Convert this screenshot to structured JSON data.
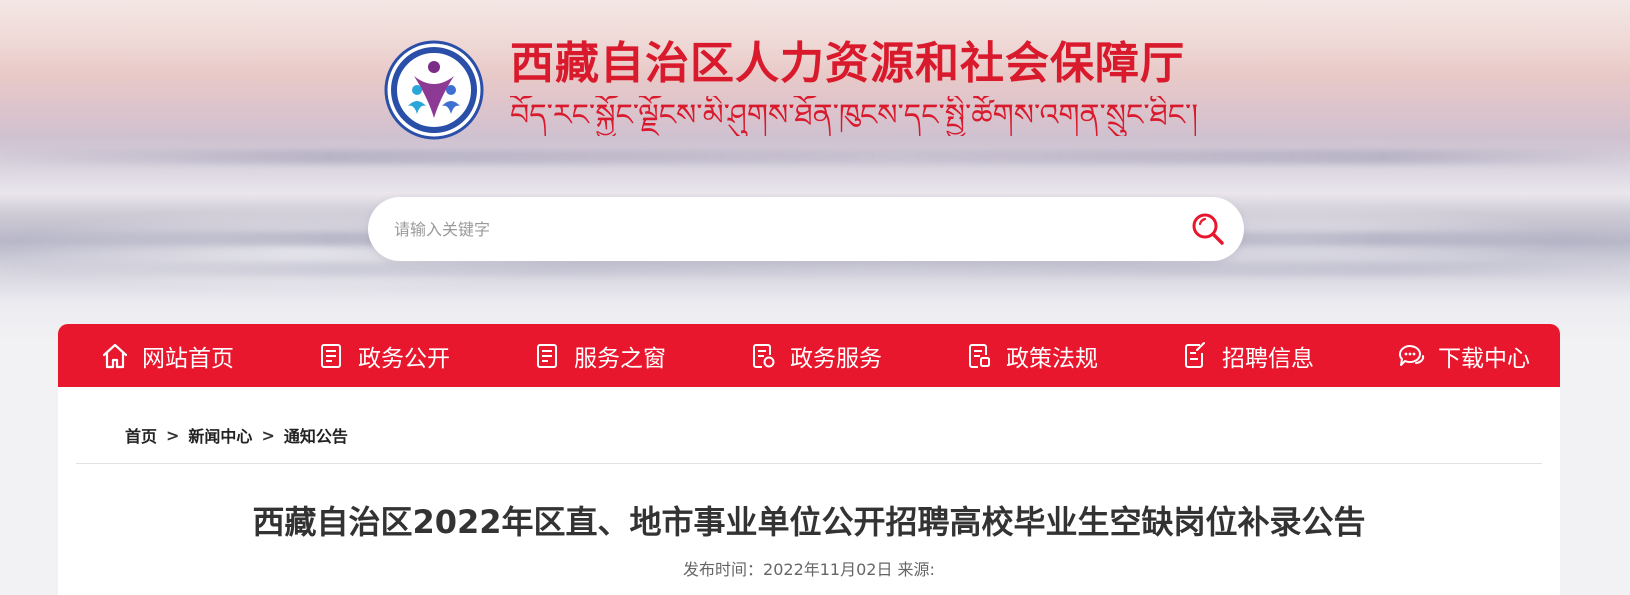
{
  "header": {
    "title_cn": "西藏自治区人力资源和社会保障厅",
    "title_tibetan": "བོད་རང་སྐྱོང་ལྗོངས་མི་ཤུགས་ཐོན་ཁུངས་དང་སྤྱི་ཚོགས་འགན་སྲུང་ཐིང་།",
    "logo_icon": "emblem-people-icon"
  },
  "search": {
    "placeholder": "请输入关键字",
    "value": "",
    "icon": "search-icon"
  },
  "nav": {
    "items": [
      {
        "label": "网站首页",
        "icon": "home-icon"
      },
      {
        "label": "政务公开",
        "icon": "document-icon"
      },
      {
        "label": "服务之窗",
        "icon": "document-icon"
      },
      {
        "label": "政务服务",
        "icon": "service-icon"
      },
      {
        "label": "政策法规",
        "icon": "policy-icon"
      },
      {
        "label": "招聘信息",
        "icon": "edit-icon"
      },
      {
        "label": "下载中心",
        "icon": "chat-icon"
      }
    ]
  },
  "breadcrumb": {
    "items": [
      "首页",
      "新闻中心",
      "通知公告"
    ],
    "separator": ">"
  },
  "article": {
    "title": "西藏自治区2022年区直、地市事业单位公开招聘高校毕业生空缺岗位补录公告",
    "meta": "发布时间：2022年11月02日 来源:"
  },
  "colors": {
    "brand_red": "#e9172d",
    "title_red": "#d9192c"
  }
}
